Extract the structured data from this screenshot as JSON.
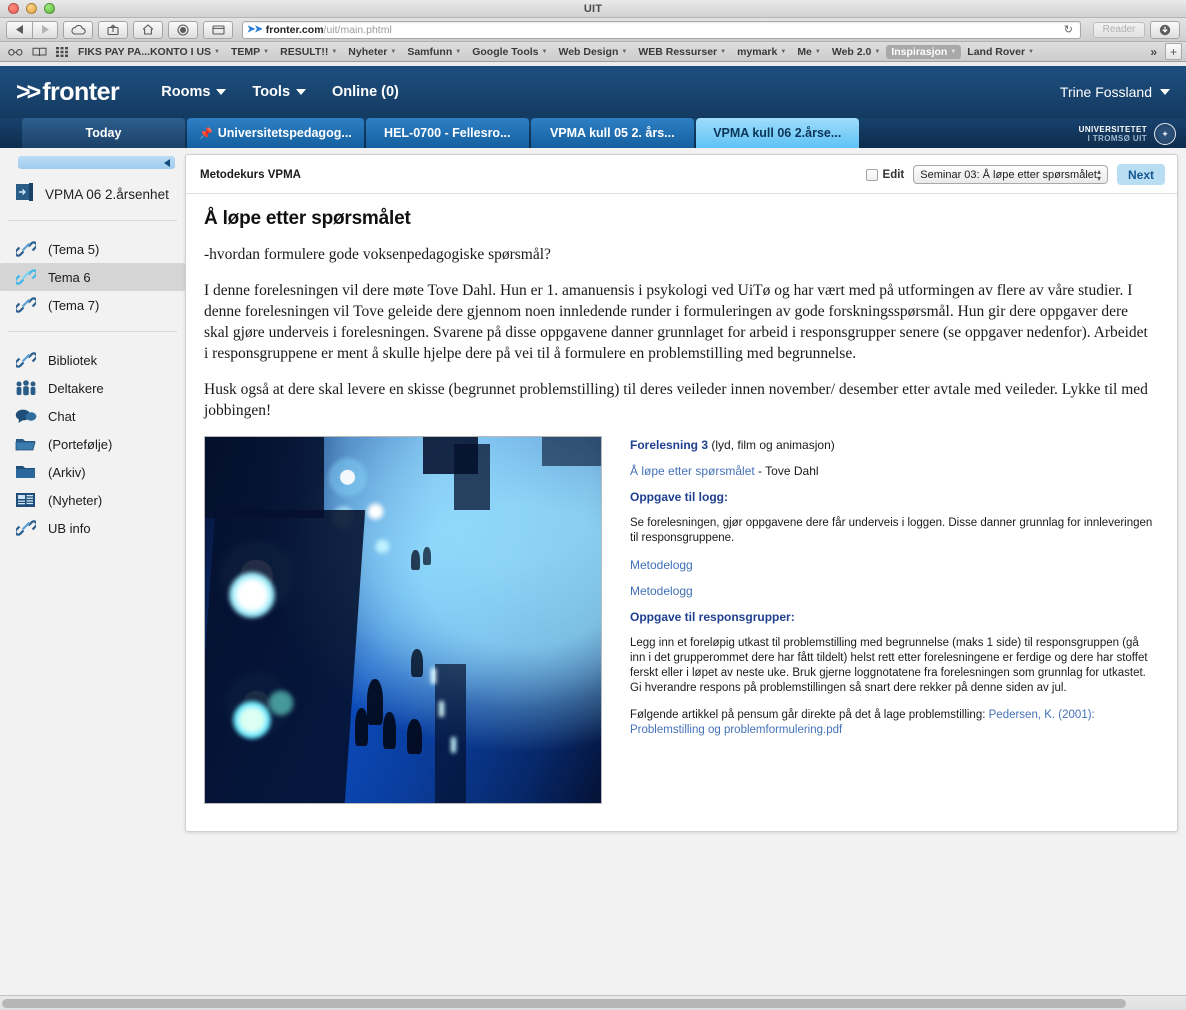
{
  "browser": {
    "window_title": "UIT",
    "traffic_lights": [
      "close-button",
      "minimize-button",
      "zoom-button"
    ],
    "nav_back": "◀",
    "nav_forward": "▶",
    "icons": [
      "icloud-icon",
      "share-icon",
      "home-icon",
      "reading-list-icon",
      "show-tab-overview-icon"
    ],
    "url_prefix": "➤➤",
    "url_bold": "fronter.com",
    "url_rest": "/uit/main.phtml",
    "reload_glyph": "↻",
    "reader_label": "Reader",
    "downloads_icon": "downloads-icon"
  },
  "bookmarks": {
    "icons": [
      "reading-glasses-icon",
      "book-icon",
      "grid-icon"
    ],
    "items": [
      {
        "label": "FIKS PAY PA...KONTO I US",
        "has_caret": true,
        "highlight": false
      },
      {
        "label": "TEMP",
        "has_caret": true,
        "highlight": false
      },
      {
        "label": "RESULT!!",
        "has_caret": true,
        "highlight": false
      },
      {
        "label": "Nyheter",
        "has_caret": true,
        "highlight": false
      },
      {
        "label": "Samfunn",
        "has_caret": true,
        "highlight": false
      },
      {
        "label": "Google Tools",
        "has_caret": true,
        "highlight": false
      },
      {
        "label": "Web Design",
        "has_caret": true,
        "highlight": false
      },
      {
        "label": "WEB Ressurser",
        "has_caret": true,
        "highlight": false
      },
      {
        "label": "mymark",
        "has_caret": true,
        "highlight": false
      },
      {
        "label": "Me",
        "has_caret": true,
        "highlight": false
      },
      {
        "label": "Web 2.0",
        "has_caret": true,
        "highlight": false
      },
      {
        "label": "Inspirasjon",
        "has_caret": true,
        "highlight": true
      },
      {
        "label": "Land Rover",
        "has_caret": true,
        "highlight": false
      }
    ],
    "overflow_label": "»",
    "add_label": "+"
  },
  "fronter": {
    "logo_chevrons": ">>",
    "logo_text": "fronter",
    "nav": [
      {
        "label": "Rooms",
        "caret": true
      },
      {
        "label": "Tools",
        "caret": true
      },
      {
        "label": "Online (0)",
        "caret": false
      }
    ],
    "user_name": "Trine Fossland",
    "tabs": [
      {
        "label": "Today",
        "style": "today",
        "pinned": false
      },
      {
        "label": "Universitetspedagog...",
        "style": "normal",
        "pinned": true
      },
      {
        "label": "HEL-0700 - Fellesro...",
        "style": "normal",
        "pinned": false
      },
      {
        "label": "VPMA kull 05 2. års...",
        "style": "normal",
        "pinned": false
      },
      {
        "label": "VPMA kull 06 2.årse...",
        "style": "active",
        "pinned": false
      }
    ],
    "uit_line1": "UNIVERSITETET",
    "uit_line2": "I TROMSØ",
    "uit_line2_sub": "UIT",
    "brand_color": "#1e4f80",
    "active_tab_color": "#5fc3f5"
  },
  "sidebar": {
    "room_title": "VPMA 06 2.årsenhet",
    "room_icon": "room-icon",
    "collapse_icon": "collapse-arrow-icon",
    "themes": [
      {
        "label": "(Tema 5)",
        "icon": "link-icon",
        "active": false
      },
      {
        "label": "Tema 6",
        "icon": "link-icon",
        "active": true
      },
      {
        "label": "(Tema 7)",
        "icon": "link-icon",
        "active": false
      }
    ],
    "tools": [
      {
        "label": "Bibliotek",
        "icon": "link-icon"
      },
      {
        "label": "Deltakere",
        "icon": "participants-icon"
      },
      {
        "label": "Chat",
        "icon": "chat-icon"
      },
      {
        "label": "(Portefølje)",
        "icon": "open-folder-icon"
      },
      {
        "label": "(Arkiv)",
        "icon": "folder-icon"
      },
      {
        "label": "(Nyheter)",
        "icon": "news-icon"
      },
      {
        "label": "UB info",
        "icon": "link-icon"
      }
    ]
  },
  "content": {
    "breadcrumb": "Metodekurs VPMA",
    "edit_label": "Edit",
    "edit_checked": false,
    "seminar_select": "Seminar 03: Å løpe etter spørsmålet",
    "next_label": "Next",
    "title": "Å løpe etter spørsmålet",
    "paragraphs": [
      "-hvordan formulere gode voksenpedagogiske spørsmål?",
      "I denne forelesningen vil dere møte Tove Dahl. Hun er 1. amanuensis i psykologi ved UiTø og har vært med på utformingen av flere av våre studier. I denne forelesningen vil Tove geleide dere gjennom noen innledende runder i formuleringen av gode forskningsspørsmål. Hun gir dere oppgaver dere skal gjøre underveis i forelesningen. Svarene på disse oppgavene danner grunnlaget for arbeid i responsgrupper senere (se oppgaver nedenfor). Arbeidet i responsgruppene er ment å skulle hjelpe dere på vei til å formulere en problemstilling med begrunnelse.",
      "Husk også at dere skal levere en skisse (begrunnet problemstilling) til deres veileder innen november/ desember etter avtale med veileder.  Lykke til med jobbingen!"
    ],
    "photo_alt": "snowy-street-night-photo",
    "right": {
      "lecture_heading_link": "Forelesning 3",
      "lecture_heading_rest": " (lyd, film og animasjon)",
      "lecture_link": "Å løpe etter spørsmålet",
      "lecture_rest": " - Tove Dahl",
      "logg_heading": "Oppgave til logg:",
      "logg_body": "Se forelesningen, gjør oppgavene dere får underveis i loggen. Disse danner grunnlag for innleveringen til responsgruppene.",
      "logg_links": [
        "Metodelogg",
        "Metodelogg"
      ],
      "response_heading": "Oppgave til responsgrupper:",
      "response_body": "Legg inn et foreløpig utkast til problemstilling med begrunnelse (maks 1 side) til responsgruppen (gå inn i det grupperommet dere har fått tildelt) helst rett etter forelesningene er ferdige og dere har stoffet ferskt eller i løpet av neste uke. Bruk gjerne loggnotatene fra forelesningen som grunnlag for utkastet. Gi hverandre respons på problemstillingen så snart dere rekker på denne siden av jul.",
      "article_intro": "Følgende artikkel på pensum går direkte på det å lage problemstilling: ",
      "article_link": "Pedersen, K. (2001): Problemstilling og problemformulering.pdf"
    }
  }
}
